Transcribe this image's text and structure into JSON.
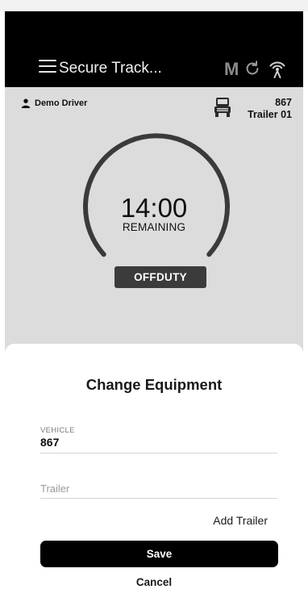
{
  "nav": {
    "title": "Secure Track...",
    "m_label": "M"
  },
  "driver": {
    "name": "Demo Driver"
  },
  "equipment": {
    "vehicle": "867",
    "trailer": "Trailer 01"
  },
  "clock": {
    "time": "14:00",
    "label": "REMAINING",
    "status": "OFFDUTY"
  },
  "sheet": {
    "title": "Change Equipment",
    "vehicle_label": "VEHICLE",
    "vehicle_value": "867",
    "trailer_placeholder": "Trailer",
    "add_trailer_label": "Add Trailer",
    "save_label": "Save",
    "cancel_label": "Cancel"
  },
  "colors": {
    "navbar_bg": "#000000",
    "main_bg": "#dcdcdc",
    "gauge": "#3a3a3a",
    "status_bg": "#3b3b3b",
    "orange": "#ef8a1e",
    "green": "#3cb24a",
    "save_bg": "#000000"
  },
  "icons": [
    "menu-icon",
    "refresh-icon",
    "signal-icon",
    "person-icon",
    "truck-icon"
  ]
}
